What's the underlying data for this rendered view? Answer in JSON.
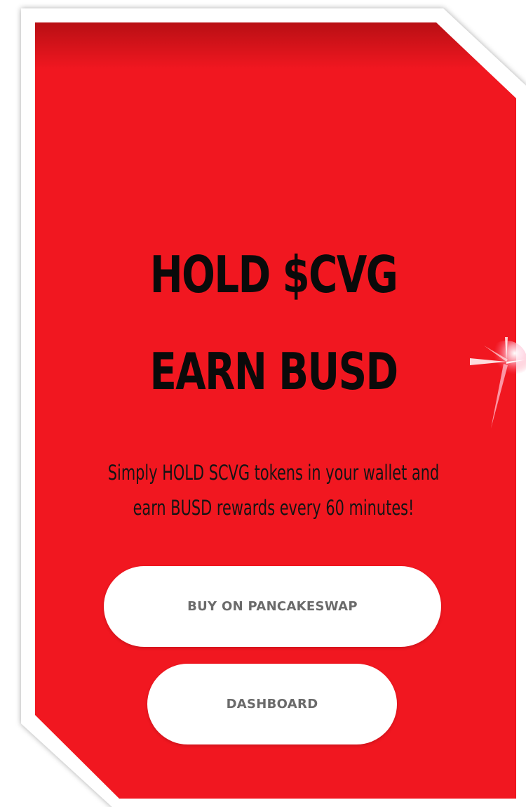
{
  "hero": {
    "headline_line1": "HOLD $CVG",
    "headline_line2": "EARN BUSD",
    "subtitle_line1": "Simply HOLD SCVG tokens in your wallet and",
    "subtitle_line2": "earn BUSD rewards every 60 minutes!"
  },
  "buttons": {
    "buy_label": "BUY ON PANCAKESWAP",
    "dashboard_label": "DASHBOARD"
  },
  "colors": {
    "panel_red": "#f11720",
    "panel_border": "#ffffff",
    "headline_text": "#0a0a0a",
    "button_bg": "#ffffff",
    "button_text": "#6b6b6b"
  },
  "icons": {
    "sparkle": "sparkle-icon"
  }
}
